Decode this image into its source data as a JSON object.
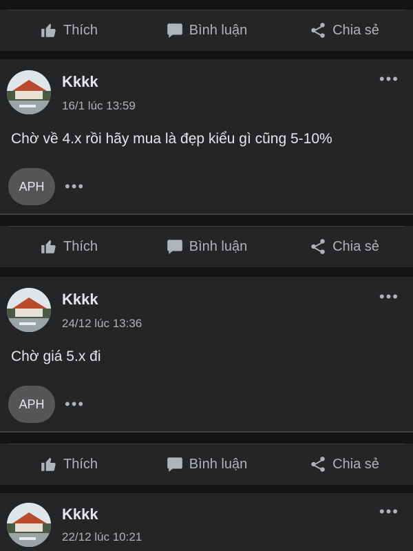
{
  "actions": {
    "like": "Thích",
    "comment": "Bình luận",
    "share": "Chia sẻ"
  },
  "posts": [
    {
      "author": "Kkkk",
      "time": "16/1 lúc 13:59",
      "text": "Chờ về 4.x rồi hãy mua là đẹp kiểu gì cũng 5-10%",
      "reaction_badge": "APH",
      "more": "•••",
      "reaction_more": "•••"
    },
    {
      "author": "Kkkk",
      "time": "24/12 lúc 13:36",
      "text": "Chờ giá 5.x đi",
      "reaction_badge": "APH",
      "more": "•••",
      "reaction_more": "•••"
    },
    {
      "author": "Kkkk",
      "time": "22/12 lúc 10:21",
      "more": "•••"
    }
  ],
  "colors": {
    "background": "#141414",
    "card": "#242526",
    "text_primary": "#e4e6eb",
    "text_secondary": "#b0b3b8"
  },
  "icons": [
    "thumbs-up-icon",
    "comment-icon",
    "share-icon",
    "more-icon"
  ]
}
